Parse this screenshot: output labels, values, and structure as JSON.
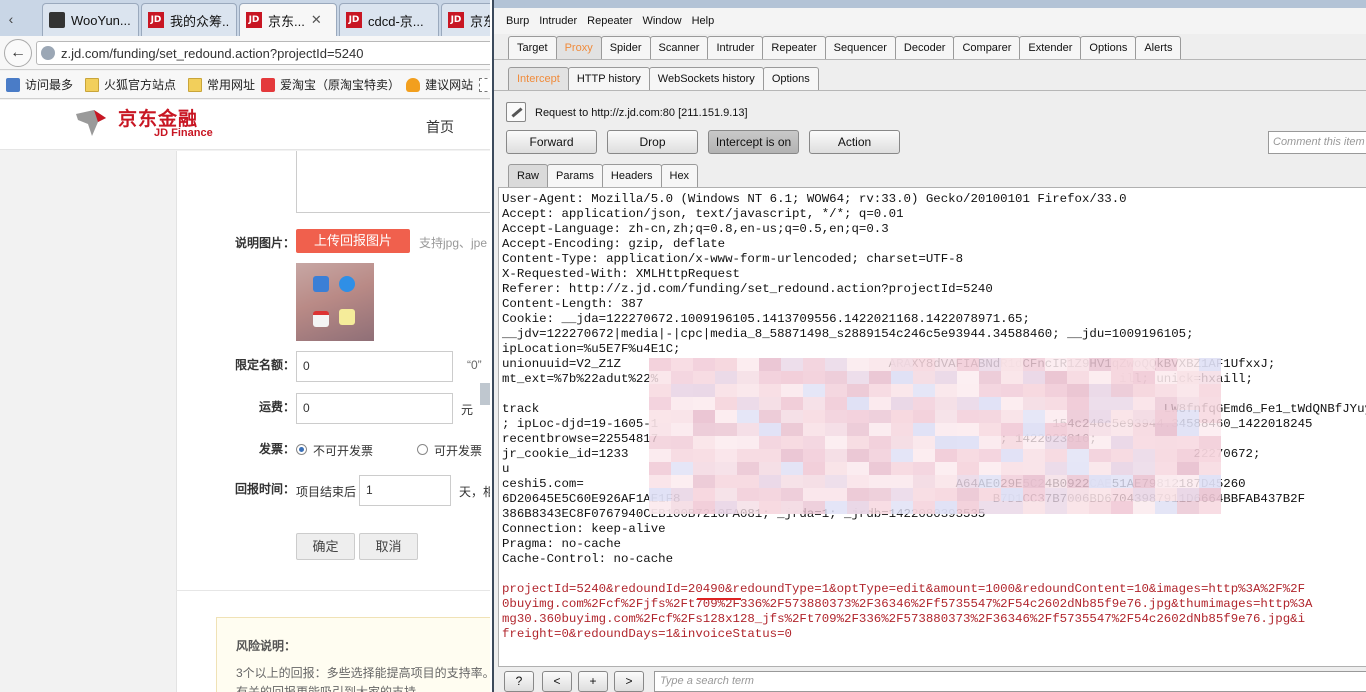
{
  "browser": {
    "tabs": [
      {
        "label": "WooYun...",
        "icon": "wooyun-icon"
      },
      {
        "label": "我的众筹...",
        "icon": "jd-icon"
      },
      {
        "label": "京东...",
        "icon": "jd-icon"
      },
      {
        "label": "cdcd-京...",
        "icon": "jd-icon"
      },
      {
        "label": "京东",
        "icon": "jd-icon"
      }
    ],
    "tab_close": "✕",
    "url": "z.jd.com/funding/set_redound.action?projectId=5240",
    "bookmarks": [
      "访问最多",
      "火狐官方站点",
      "常用网址",
      "爱淘宝（原淘宝特卖）",
      "建议网站"
    ]
  },
  "jd": {
    "logo_cn": "京东金融",
    "logo_en": "JD Finance",
    "nav_home": "首页",
    "form": {
      "image_label": "说明图片：",
      "upload_button": "上传回报图片",
      "upload_hint": "支持jpg、jpe",
      "limit_label": "限定名额：",
      "limit_value": "0",
      "limit_hint": "“0”",
      "shipping_label": "运费：",
      "shipping_value": "0",
      "shipping_unit": "元",
      "invoice_label": "发票：",
      "invoice_option_no": "不可开发票",
      "invoice_option_yes": "可开发票",
      "return_time_label": "回报时间：",
      "return_time_prefix": "项目结束后",
      "return_time_value": "1",
      "return_time_suffix": "天，相",
      "confirm_button": "确定",
      "cancel_button": "取消"
    },
    "risk": {
      "title": "风险说明：",
      "line1": "3个以上的回报：多些选择能提高项目的支持率。",
      "line2": "有关的回报更能吸引到大家的支持"
    }
  },
  "burp": {
    "menu": [
      "Burp",
      "Intruder",
      "Repeater",
      "Window",
      "Help"
    ],
    "main_tabs": [
      "Target",
      "Proxy",
      "Spider",
      "Scanner",
      "Intruder",
      "Repeater",
      "Sequencer",
      "Decoder",
      "Comparer",
      "Extender",
      "Options",
      "Alerts"
    ],
    "main_selected": "Proxy",
    "proxy_tabs": [
      "Intercept",
      "HTTP history",
      "WebSockets history",
      "Options"
    ],
    "proxy_selected": "Intercept",
    "request_to": "Request to http://z.jd.com:80  [211.151.9.13]",
    "buttons": {
      "forward": "Forward",
      "drop": "Drop",
      "intercept": "Intercept is on",
      "action": "Action"
    },
    "comment_placeholder": "Comment this item",
    "view_tabs": [
      "Raw",
      "Params",
      "Headers",
      "Hex"
    ],
    "view_selected": "Raw",
    "request_lines": [
      {
        "text": "User-Agent: Mozilla/5.0 (Windows NT 6.1; WOW64; rv:33.0) Gecko/20100101 Firefox/33.0",
        "red": false
      },
      {
        "text": "Accept: application/json, text/javascript, */*; q=0.01",
        "red": false
      },
      {
        "text": "Accept-Language: zh-cn,zh;q=0.8,en-us;q=0.5,en;q=0.3",
        "red": false
      },
      {
        "text": "Accept-Encoding: gzip, deflate",
        "red": false
      },
      {
        "text": "Content-Type: application/x-www-form-urlencoded; charset=UTF-8",
        "red": false
      },
      {
        "text": "X-Requested-With: XMLHttpRequest",
        "red": false
      },
      {
        "text": "Referer: http://z.jd.com/funding/set_redound.action?projectId=5240",
        "red": false
      },
      {
        "text": "Content-Length: 387",
        "red": false
      },
      {
        "text": "Cookie: __jda=122270672.1009196105.1413709556.1422021168.1422078971.65;",
        "red": false
      },
      {
        "text": "__jdv=122270672|media|-|cpc|media_8_58871498_s2889154c246c5e93944.34588460; __jdu=1009196105;",
        "red": false
      },
      {
        "text": "ipLocation=%u5E7F%u4E1C;",
        "red": false
      },
      {
        "text": "unionuuid=V2_Z1Z                                    ARAXY8dVAFIABNdR1dCFncIR1Z9HV1qZwoQQkBVXBZ1AF1UfxxJ;",
        "red": false
      },
      {
        "text": "mt_ext=%7b%22adut%22%                                                              ill; unick=hxaill;",
        "red": false
      },
      {
        "text": "",
        "red": false
      },
      {
        "text": "track                                                                                    LW8fnfqGEmd6_Fe1_tWdQNBfJYuy6mjzk",
        "red": false
      },
      {
        "text": "; ipLoc-djd=19-1605-1                                                     154c246c5e93944.34588460_1422018245",
        "red": false
      },
      {
        "text": "recentbrowse=22554817                                              ; 1422023816;",
        "red": false
      },
      {
        "text": "jr_cookie_id=1233                                                                            22270672;",
        "red": false
      },
      {
        "text": "u",
        "red": false
      },
      {
        "text": "ceshi5.com=                                                  A64AE029E5C24B0922CAE51AE79812187D45260",
        "red": false
      },
      {
        "text": "6D20645E5C60E926AF1AE1F8                                          B7D1CC37B7006BD67043987911D6664BBFAB437B2F",
        "red": false
      },
      {
        "text": "386B8343EC8F0767940CEB100B7210FA081; _jrda=1; _jrdb=1422080393535",
        "red": false
      },
      {
        "text": "Connection: keep-alive",
        "red": false
      },
      {
        "text": "Pragma: no-cache",
        "red": false
      },
      {
        "text": "Cache-Control: no-cache",
        "red": false
      },
      {
        "text": "",
        "red": false
      },
      {
        "text": "projectId=5240&redoundId=20490&redoundType=1&optType=edit&amount=1000&redoundContent=10&images=http%3A%2F%2F",
        "red": true
      },
      {
        "text": "0buyimg.com%2Fcf%2Fjfs%2Ft709%2F336%2F573880373%2F36346%2Ff5735547%2F54c2602dNb85f9e76.jpg&thumimages=http%3A",
        "red": true
      },
      {
        "text": "mg30.360buyimg.com%2Fcf%2Fs128x128_jfs%2Ft709%2F336%2F573880373%2F36346%2Ff5735547%2F54c2602dNb85f9e76.jpg&i",
        "red": true
      },
      {
        "text": "freight=0&redoundDays=1&invoiceStatus=0",
        "red": true
      }
    ],
    "bottom_buttons": [
      "?",
      "<",
      "+",
      ">"
    ],
    "search_placeholder": "Type a search term"
  },
  "colors": {
    "jd_red": "#c81623",
    "upload_red": "#f0604d",
    "burp_orange": "#f08b3b",
    "param_red": "#b1262d"
  }
}
